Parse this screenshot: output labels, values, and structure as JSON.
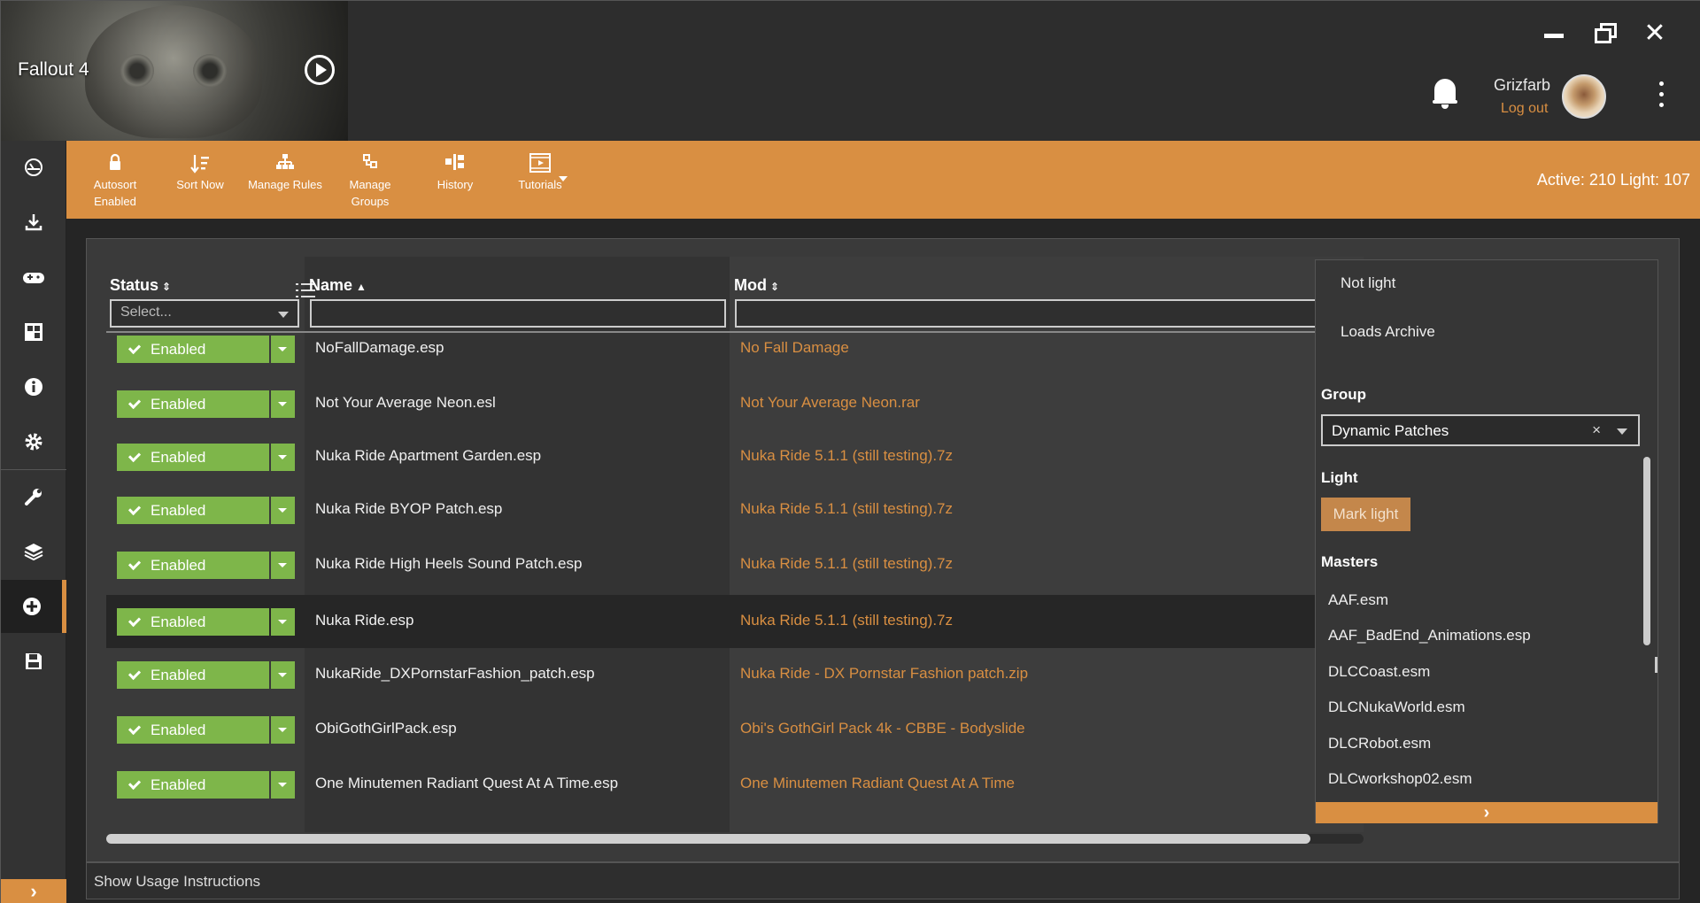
{
  "header": {
    "game_title": "Fallout 4",
    "user_name": "Grizfarb",
    "logout_label": "Log out"
  },
  "toolbar": {
    "autosort_label": "Autosort Enabled",
    "sortnow_label": "Sort Now",
    "managerules_label": "Manage Rules",
    "managegroups_label": "Manage Groups",
    "history_label": "History",
    "tutorials_label": "Tutorials",
    "active_counts": "Active: 210 Light: 107"
  },
  "table": {
    "col_status": "Status",
    "col_name": "Name",
    "col_mod": "Mod",
    "status_placeholder": "Select...",
    "status_label": "Enabled",
    "rows": [
      {
        "name": "NoFallDamage.esp",
        "mod": "No Fall Damage"
      },
      {
        "name": "Not Your Average Neon.esl",
        "mod": "Not Your Average Neon.rar"
      },
      {
        "name": "Nuka Ride Apartment Garden.esp",
        "mod": "Nuka Ride 5.1.1 (still testing).7z"
      },
      {
        "name": "Nuka Ride BYOP Patch.esp",
        "mod": "Nuka Ride 5.1.1 (still testing).7z"
      },
      {
        "name": "Nuka Ride High Heels Sound Patch.esp",
        "mod": "Nuka Ride 5.1.1 (still testing).7z"
      },
      {
        "name": "Nuka Ride.esp",
        "mod": "Nuka Ride 5.1.1 (still testing).7z"
      },
      {
        "name": "NukaRide_DXPornstarFashion_patch.esp",
        "mod": "Nuka Ride - DX Pornstar Fashion patch.zip"
      },
      {
        "name": "ObiGothGirlPack.esp",
        "mod": "Obi's GothGirl Pack 4k - CBBE - Bodyslide"
      },
      {
        "name": "One Minutemen Radiant Quest At A Time.esp",
        "mod": "One Minutemen Radiant Quest At A Time"
      }
    ]
  },
  "details": {
    "option_not_light": "Not light",
    "option_loads_archive": "Loads Archive",
    "group_heading": "Group",
    "group_value": "Dynamic Patches",
    "light_heading": "Light",
    "mark_light_label": "Mark light",
    "masters_heading": "Masters",
    "masters": [
      "AAF.esm",
      "AAF_BadEnd_Animations.esp",
      "DLCCoast.esm",
      "DLCNukaWorld.esm",
      "DLCRobot.esm",
      "DLCworkshop02.esm"
    ]
  },
  "footer": {
    "usage_label": "Show Usage Instructions"
  }
}
